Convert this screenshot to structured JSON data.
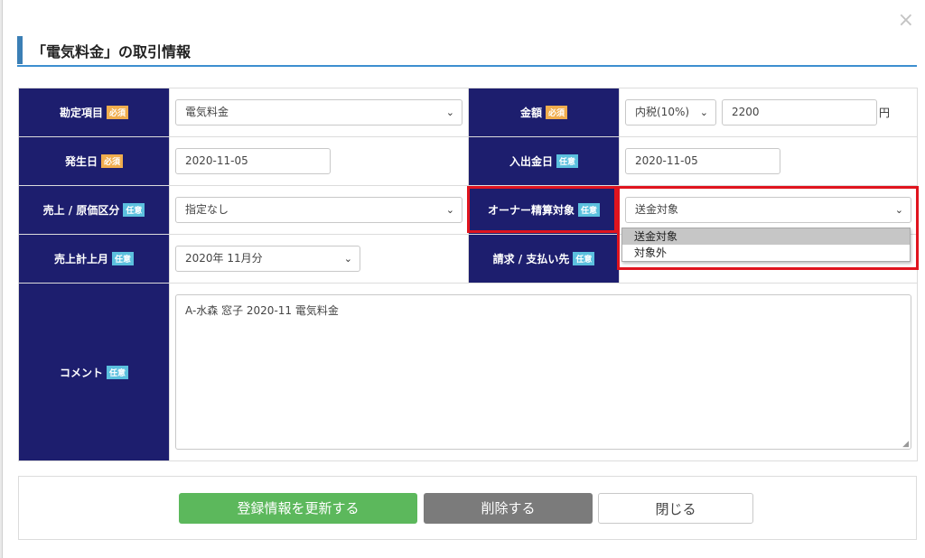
{
  "dialog": {
    "title": "「電気料金」の取引情報",
    "close_icon": "×"
  },
  "badges": {
    "required": "必須",
    "optional": "任意"
  },
  "fields": {
    "account_item": {
      "label": "勘定項目",
      "value": "電気料金"
    },
    "amount": {
      "label": "金額",
      "tax_value": "内税(10%)",
      "value": "2200",
      "unit": "円"
    },
    "occurrence_date": {
      "label": "発生日",
      "value": "2020-11-05"
    },
    "payment_date": {
      "label": "入出金日",
      "value": "2020-11-05"
    },
    "sales_cost_type": {
      "label": "売上 / 原価区分",
      "value": "指定なし"
    },
    "owner_settlement": {
      "label": "オーナー精算対象",
      "value": "送金対象",
      "options": [
        "送金対象",
        "対象外"
      ]
    },
    "sales_month": {
      "label": "売上計上月",
      "value": "2020年 11月分"
    },
    "billing_to": {
      "label": "請求 / 支払い先"
    },
    "comment": {
      "label": "コメント",
      "value": "A-水森 窓子 2020-11 電気料金"
    }
  },
  "buttons": {
    "update": "登録情報を更新する",
    "delete": "削除する",
    "close": "閉じる"
  },
  "colors": {
    "label_bg": "#1d1e6e",
    "required_badge": "#f0ad4e",
    "optional_badge": "#5bc0de",
    "highlight": "#e0141e",
    "update_button": "#5cb85c",
    "delete_button": "#7b7b7b",
    "title_accent": "#3b7fb5"
  }
}
